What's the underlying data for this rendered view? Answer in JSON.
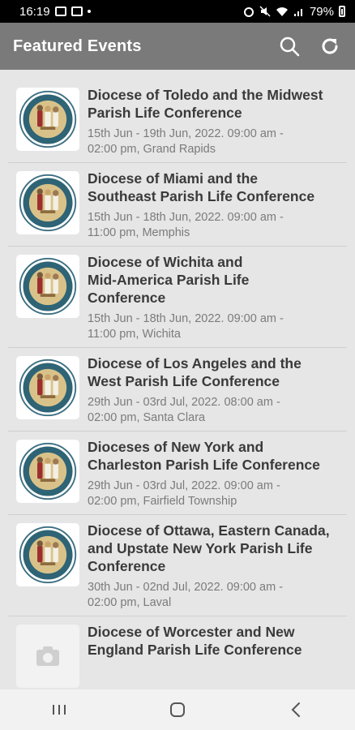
{
  "status": {
    "time": "16:19",
    "battery": "79%"
  },
  "app_bar": {
    "title": "Featured Events",
    "search_icon": "search-icon",
    "refresh_icon": "refresh-icon"
  },
  "colors": {
    "app_bar": "#7a7a7a",
    "background": "#e6e6e6",
    "title_text": "#3a3a3a",
    "detail_text": "#7b7b7b"
  },
  "events": [
    {
      "title": "Diocese of Toledo and the Midwest\nParish Life Conference",
      "details": "15th Jun - 19th Jun, 2022. 09:00 am -\n02:00 pm, Grand Rapids"
    },
    {
      "title": "Diocese of Miami and the\nSoutheast Parish Life Conference",
      "details": "15th Jun - 18th Jun, 2022. 09:00 am -\n11:00 pm, Memphis"
    },
    {
      "title": "Diocese of Wichita and\nMid-America Parish Life\nConference",
      "details": "15th Jun - 18th Jun, 2022. 09:00 am -\n11:00 pm, Wichita"
    },
    {
      "title": "Diocese of Los Angeles and the\nWest Parish Life Conference",
      "details": "29th Jun - 03rd Jul, 2022. 08:00 am -\n02:00 pm, Santa Clara"
    },
    {
      "title": "Dioceses of New York and\nCharleston Parish Life Conference",
      "details": "29th Jun - 03rd Jul, 2022. 09:00 am -\n02:00 pm, Fairfield Township"
    },
    {
      "title": "Diocese of Ottawa, Eastern Canada,\nand Upstate New York Parish Life\nConference",
      "details": "30th Jun - 02nd Jul, 2022. 09:00 am -\n02:00 pm, Laval"
    },
    {
      "title": "Diocese of Worcester and New\nEngland Parish Life Conference",
      "details": ""
    }
  ]
}
